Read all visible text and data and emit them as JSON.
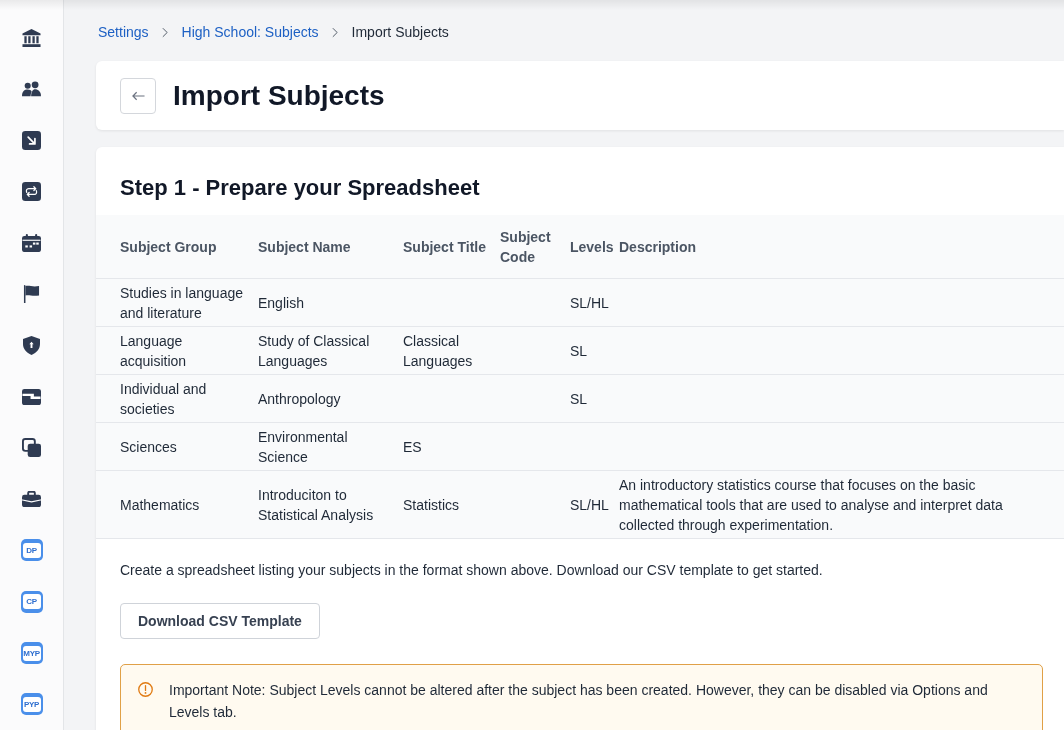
{
  "sidebar": {
    "tiles": [
      {
        "label": "DP"
      },
      {
        "label": "CP"
      },
      {
        "label": "MYP"
      },
      {
        "label": "PYP"
      }
    ]
  },
  "breadcrumb": [
    {
      "label": "Settings",
      "kind": "link"
    },
    {
      "label": "High School: Subjects",
      "kind": "link"
    },
    {
      "label": "Import Subjects",
      "kind": "current"
    }
  ],
  "header": {
    "title": "Import Subjects"
  },
  "step": {
    "title": "Step 1 - Prepare your Spreadsheet",
    "table": {
      "columns": [
        "Subject Group",
        "Subject Name",
        "Subject Title",
        "Subject Code",
        "Levels",
        "Description"
      ],
      "rows": [
        {
          "subject_group": "Studies in language and literature",
          "subject_name": "English",
          "levels": "SL/HL"
        },
        {
          "subject_group": "Language acquisition",
          "subject_name": "Study of Classical Languages",
          "subject_title": "Classical Languages",
          "levels": "SL"
        },
        {
          "subject_group": "Individual and societies",
          "subject_name": "Anthropology",
          "levels": "SL"
        },
        {
          "subject_group": "Sciences",
          "subject_name": "Environmental Science",
          "subject_title": "ES"
        },
        {
          "subject_group": "Mathematics",
          "subject_name": "Introduciton to Statistical Analysis",
          "subject_title": "Statistics",
          "levels": "SL/HL",
          "description": "An introductory statistics course that focuses on the basic\nmathematical tools that are used to analyse and interpret data collected through experimentation."
        }
      ]
    },
    "instructions": "Create a spreadsheet listing your subjects in the format shown above. Download our CSV template to get started.",
    "download_button": "Download CSV Template",
    "note": "Important Note: Subject Levels cannot be altered after the subject has been created. However, they can be disabled via Options and Levels tab."
  }
}
